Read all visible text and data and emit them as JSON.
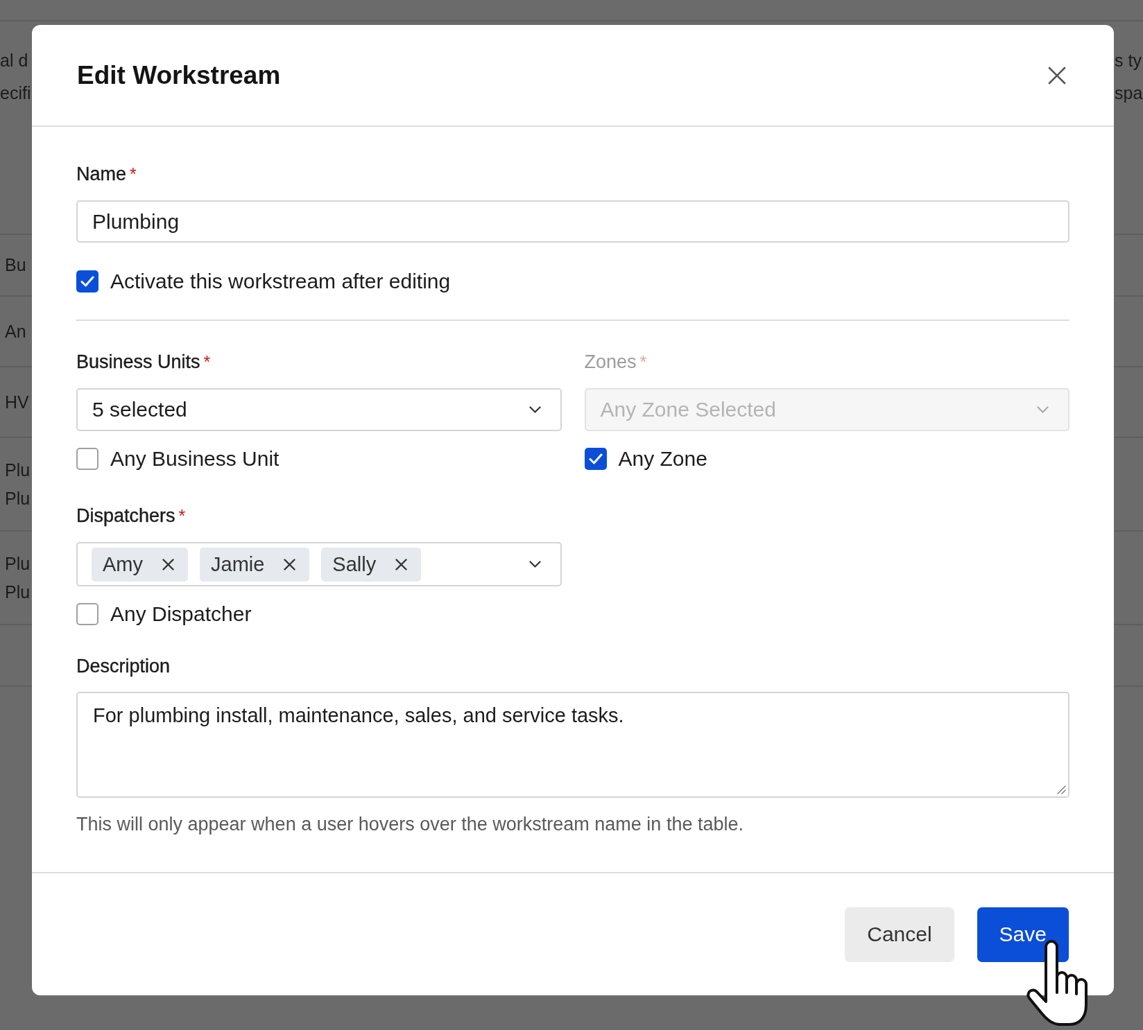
{
  "background_page": {
    "intro": {
      "left_lines": [
        "al d",
        "ecifi"
      ],
      "right_lines": [
        "s ty",
        "spa"
      ]
    },
    "table_rows": [
      {
        "lines": [
          "Bu"
        ]
      },
      {
        "lines": [
          "An"
        ]
      },
      {
        "lines": [
          "HV"
        ]
      },
      {
        "lines": [
          "Plu",
          "Plu"
        ]
      },
      {
        "lines": [
          "Plu",
          "Plu"
        ]
      }
    ]
  },
  "dialog": {
    "title": "Edit Workstream",
    "name": {
      "label": "Name",
      "required_mark": "*",
      "value": "Plumbing"
    },
    "activate": {
      "label": "Activate this workstream after editing",
      "checked": true
    },
    "business_units": {
      "label": "Business Units",
      "required_mark": "*",
      "value": "5 selected",
      "disabled": false,
      "any_option": {
        "label": "Any Business Unit",
        "checked": false
      }
    },
    "zones": {
      "label": "Zones",
      "required_mark": "*",
      "value": "Any Zone Selected",
      "disabled": true,
      "any_option": {
        "label": "Any Zone",
        "checked": true
      }
    },
    "dispatchers": {
      "label": "Dispatchers",
      "required_mark": "*",
      "chips": [
        "Amy",
        "Jamie",
        "Sally"
      ],
      "any_option": {
        "label": "Any Dispatcher",
        "checked": false
      }
    },
    "description": {
      "label": "Description",
      "value": "For plumbing install, maintenance, sales, and service tasks.",
      "help": "This will only appear when a user hovers over the workstream name in the table."
    },
    "buttons": [
      {
        "label": "Cancel",
        "kind": "secondary"
      },
      {
        "label": "Save",
        "kind": "primary"
      }
    ]
  }
}
